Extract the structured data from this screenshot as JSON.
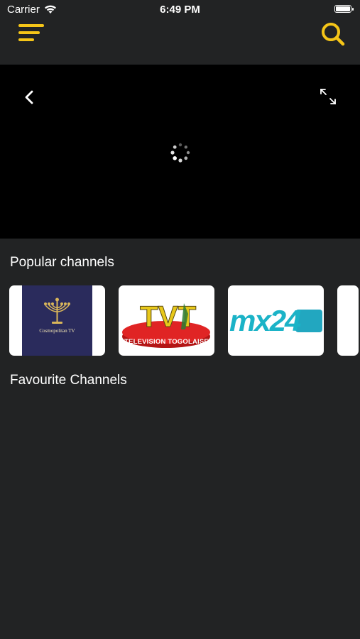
{
  "status": {
    "carrier": "Carrier",
    "time": "6:49 PM"
  },
  "nav": {
    "menu_icon": "menu-icon",
    "search_icon": "search-icon",
    "accent": "#F5C518"
  },
  "player": {
    "back_icon": "chevron-left-icon",
    "expand_icon": "expand-icon",
    "loading_icon": "spinner-icon"
  },
  "sections": {
    "popular": "Popular channels",
    "favourite": "Favourite Channels"
  },
  "channels": [
    {
      "name": "Cosmopolitan TV",
      "logo_text": "Cosmopolitan TV"
    },
    {
      "name": "TVT",
      "logo_text": "TELEVISION TOGOLAISE"
    },
    {
      "name": "MX24",
      "logo_text": "mx24"
    },
    {
      "name": "",
      "logo_text": ""
    }
  ],
  "colors": {
    "background": "#222324",
    "player": "#000000",
    "accent": "#F5C518"
  }
}
